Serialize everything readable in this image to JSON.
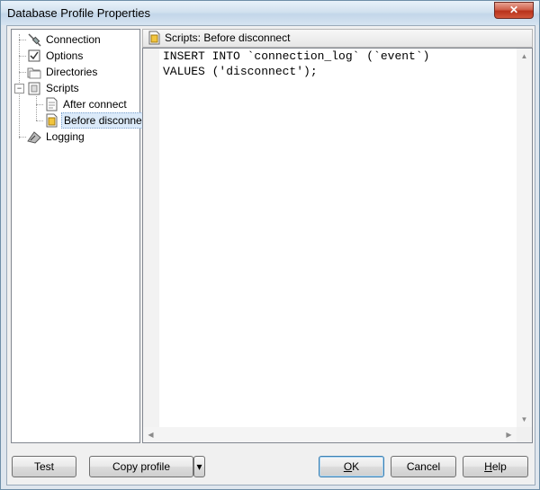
{
  "window": {
    "title": "Database Profile Properties",
    "close_glyph": "✕"
  },
  "tree": {
    "items": [
      {
        "label": "Connection",
        "icon": "connection-plug-icon"
      },
      {
        "label": "Options",
        "icon": "options-checkbox-icon"
      },
      {
        "label": "Directories",
        "icon": "directories-folder-icon"
      },
      {
        "label": "Scripts",
        "icon": "scripts-icon",
        "expander": "−"
      },
      {
        "label": "After connect",
        "icon": "script-page-icon"
      },
      {
        "label": "Before disconnec",
        "icon": "script-page-highlight-icon",
        "selected": true
      },
      {
        "label": "Logging",
        "icon": "logging-icon"
      }
    ]
  },
  "panel": {
    "header": "Scripts: Before disconnect"
  },
  "editor": {
    "lines": [
      "INSERT INTO `connection_log` (`event`)",
      "VALUES ('disconnect');"
    ]
  },
  "buttons": {
    "test": "Test",
    "copy_profile": "Copy profile",
    "dropdown_glyph": "▾",
    "ok_underlined": "O",
    "ok_rest": "K",
    "cancel": "Cancel",
    "help_underlined": "H",
    "help_rest": "elp"
  },
  "colors": {
    "selection": "#dbeaf9",
    "default_button_border": "#3c7fb1",
    "close_button": "#c1412b"
  }
}
